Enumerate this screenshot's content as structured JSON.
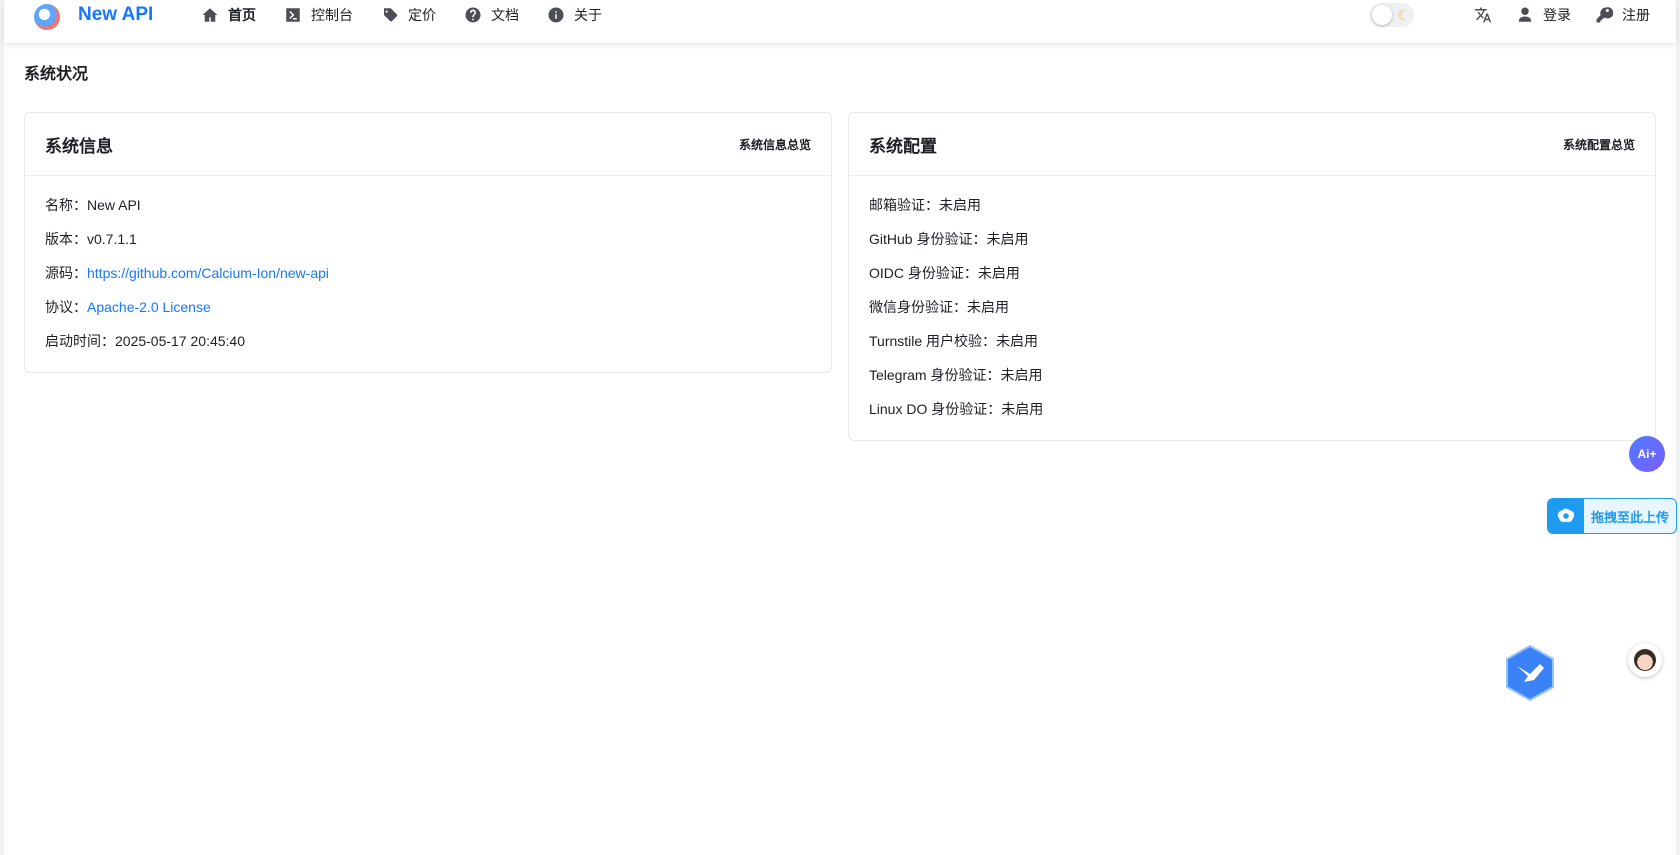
{
  "brand": {
    "name": "New API",
    "accent": "#1677ff"
  },
  "nav": {
    "items": [
      {
        "label": "首页",
        "icon": "home-icon",
        "active": true
      },
      {
        "label": "控制台",
        "icon": "terminal-icon"
      },
      {
        "label": "定价",
        "icon": "tag-icon"
      },
      {
        "label": "文档",
        "icon": "question-circle-icon"
      },
      {
        "label": "关于",
        "icon": "info-circle-icon"
      }
    ]
  },
  "right_tools": {
    "login_label": "登录",
    "register_label": "注册",
    "theme_icon": "moon-icon",
    "language_icon": "translate-icon"
  },
  "page_title": "系统状况",
  "system_info": {
    "title": "系统信息",
    "link": "系统信息总览",
    "name_label": "名称：",
    "name_value": "New API",
    "version_label": "版本：",
    "version_value": "v0.7.1.1",
    "source_label": "源码：",
    "source_value": "https://github.com/Calcium-Ion/new-api",
    "license_label": "协议：",
    "license_value": "Apache-2.0 License",
    "start_label": "启动时间：",
    "start_value": "2025-05-17 20:45:40"
  },
  "system_config": {
    "title": "系统配置",
    "link": "系统配置总览",
    "rows": [
      "邮箱验证：未启用",
      "GitHub 身份验证：未启用",
      "OIDC 身份验证：未启用",
      "微信身份验证：未启用",
      "Turnstile 用户校验：未启用",
      "Telegram 身份验证：未启用",
      "Linux DO 身份验证：未启用"
    ]
  },
  "widgets": {
    "ai_label": "Ai+",
    "upload_label": "拖拽至此上传"
  }
}
